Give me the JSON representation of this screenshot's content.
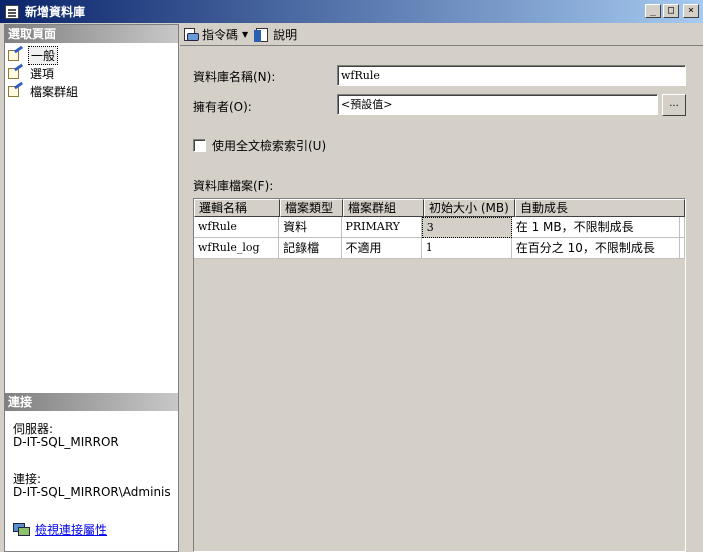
{
  "window": {
    "title": "新增資料庫",
    "minimize": "_",
    "maximize": "□",
    "close": "×"
  },
  "left": {
    "select_page_header": "選取頁面",
    "pages": [
      {
        "label": "一般",
        "icon": "general-page-icon",
        "selected": true
      },
      {
        "label": "選項",
        "icon": "options-page-icon",
        "selected": false
      },
      {
        "label": "檔案群組",
        "icon": "filegroups-page-icon",
        "selected": false
      }
    ],
    "connection_header": "連接",
    "server_label": "伺服器:",
    "server_value": "D-IT-SQL_MIRROR",
    "connection_label": "連接:",
    "connection_value": "D-IT-SQL_MIRROR\\Administratc",
    "view_props_link": "檢視連接屬性"
  },
  "toolbar": {
    "script_label": "指令碼",
    "help_label": "說明"
  },
  "form": {
    "db_name_label": "資料庫名稱(N):",
    "db_name_value": "wfRule",
    "owner_label": "擁有者(O):",
    "owner_value": "<預設值>",
    "ellipsis_label": "...",
    "fulltext_label": "使用全文檢索索引(U)",
    "files_label": "資料庫檔案(F):"
  },
  "files_table": {
    "columns": [
      "邏輯名稱",
      "檔案類型",
      "檔案群組",
      "初始大小 (MB)",
      "自動成長"
    ],
    "rows": [
      [
        "wfRule",
        "資料",
        "PRIMARY",
        "3",
        "在 1 MB，不限制成長"
      ],
      [
        "wfRule_log",
        "記錄檔",
        "不適用",
        "1",
        "在百分之 10，不限制成長"
      ]
    ]
  },
  "colors": {
    "title_start": "#0a246a",
    "title_end": "#a6caf0",
    "face": "#d4d0c8",
    "link": "#0000ee"
  }
}
